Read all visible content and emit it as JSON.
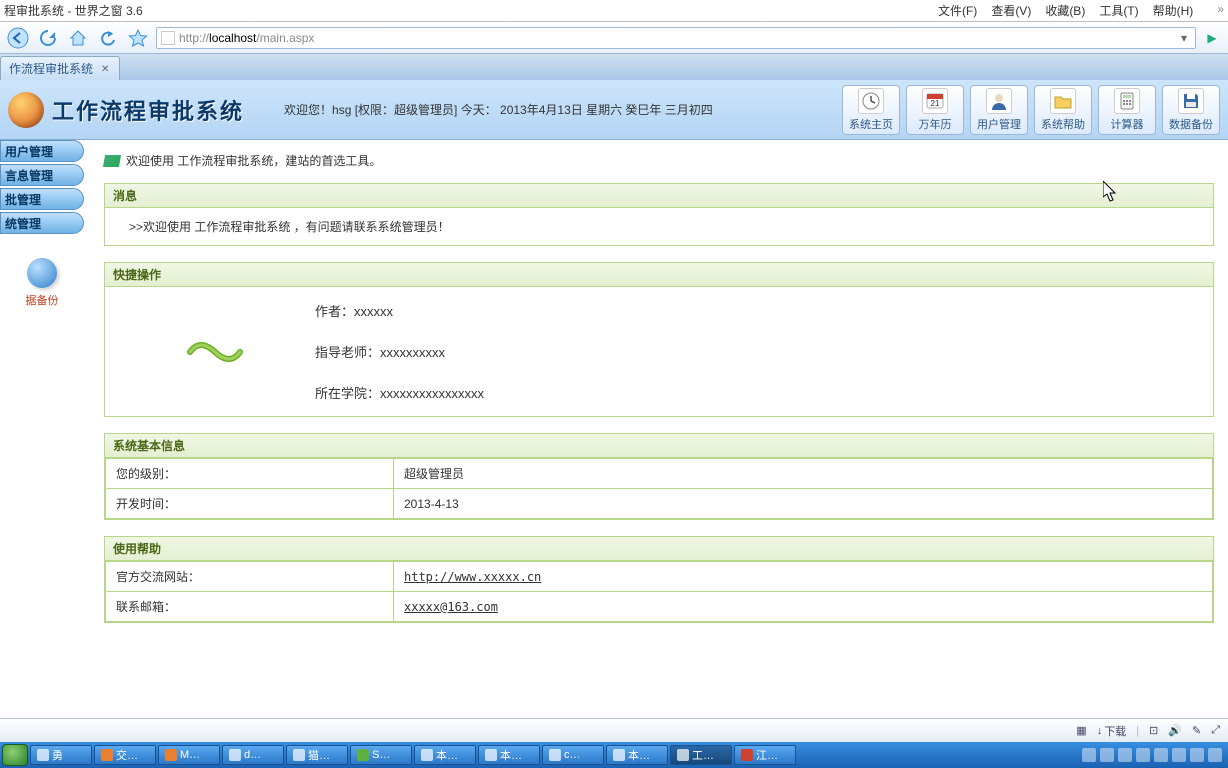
{
  "titlebar": {
    "text": "程审批系统 - 世界之窗 3.6"
  },
  "menu": {
    "file": "文件(F)",
    "view": "查看(V)",
    "favorites": "收藏(B)",
    "tools": "工具(T)",
    "help": "帮助(H)"
  },
  "url": {
    "prefix": "http://",
    "host": "localhost",
    "path": "/main.aspx"
  },
  "tab": {
    "title": "作流程审批系统"
  },
  "banner": {
    "title": "工作流程审批系统",
    "welcome": "欢迎您！hsg [权限：超级管理员] 今天： 2013年4月13日 星期六 癸巳年 三月初四",
    "btns": {
      "home": "系统主页",
      "calendar": "万年历",
      "users": "用户管理",
      "help": "系统帮助",
      "calc": "计算器",
      "backup": "数据备份"
    },
    "cal_num": "21"
  },
  "sidebar": {
    "items": [
      "用户管理",
      "言息管理",
      "批管理",
      "统管理"
    ],
    "extra_label": "据备份"
  },
  "content": {
    "welcome": "欢迎使用 工作流程审批系统，建站的首选工具。",
    "panel_messages": {
      "title": "消息",
      "body": ">>欢迎使用 工作流程审批系统 ，有问题请联系系统管理员！"
    },
    "panel_quick": {
      "title": "快捷操作",
      "author_label": "作者：",
      "author_value": "xxxxxx",
      "teacher_label": "指导老师：",
      "teacher_value": "xxxxxxxxxx",
      "college_label": "所在学院：",
      "college_value": "xxxxxxxxxxxxxxxx"
    },
    "panel_sysinfo": {
      "title": "系统基本信息",
      "level_label": "您的级别：",
      "level_value": "超级管理员",
      "devtime_label": "开发时间：",
      "devtime_value": "2013-4-13"
    },
    "panel_help": {
      "title": "使用帮助",
      "site_label": "官方交流网站：",
      "site_value": "http://www.xxxxx.cn",
      "mail_label": "联系邮箱：",
      "mail_value": "xxxxx@163.com"
    }
  },
  "statusbar": {
    "download": "下载"
  },
  "taskbar": {
    "items": [
      "交…",
      "M…",
      "d…",
      "猫…",
      "S…",
      "本…",
      "本…",
      "c…",
      "本…",
      "工…",
      "江…"
    ]
  }
}
